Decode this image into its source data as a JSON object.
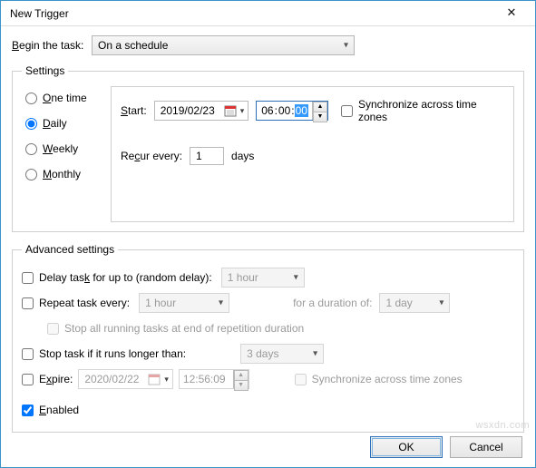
{
  "window": {
    "title": "New Trigger"
  },
  "begin": {
    "label": "Begin the task:",
    "value": "On a schedule"
  },
  "settings": {
    "legend": "Settings",
    "frequency": {
      "one_time": "One time",
      "daily": "Daily",
      "weekly": "Weekly",
      "monthly": "Monthly",
      "selected": "daily"
    },
    "start_label": "Start:",
    "start_date": "2019/02/23",
    "start_time": {
      "h": "06",
      "m": "00",
      "s": "00"
    },
    "sync_label": "Synchronize across time zones",
    "recur_label": "Recur every:",
    "recur_value": "1",
    "recur_unit": "days"
  },
  "advanced": {
    "legend": "Advanced settings",
    "delay": {
      "label": "Delay task for up to (random delay):",
      "value": "1 hour"
    },
    "repeat": {
      "label": "Repeat task every:",
      "value": "1 hour",
      "duration_label": "for a duration of:",
      "duration_value": "1 day"
    },
    "stop_all": "Stop all running tasks at end of repetition duration",
    "stop_long": {
      "label": "Stop task if it runs longer than:",
      "value": "3 days"
    },
    "expire": {
      "label": "Expire:",
      "date": "2020/02/22",
      "time": "12:56:09",
      "sync": "Synchronize across time zones"
    },
    "enabled_label": "Enabled"
  },
  "buttons": {
    "ok": "OK",
    "cancel": "Cancel"
  },
  "watermark": "wsxdn.com"
}
